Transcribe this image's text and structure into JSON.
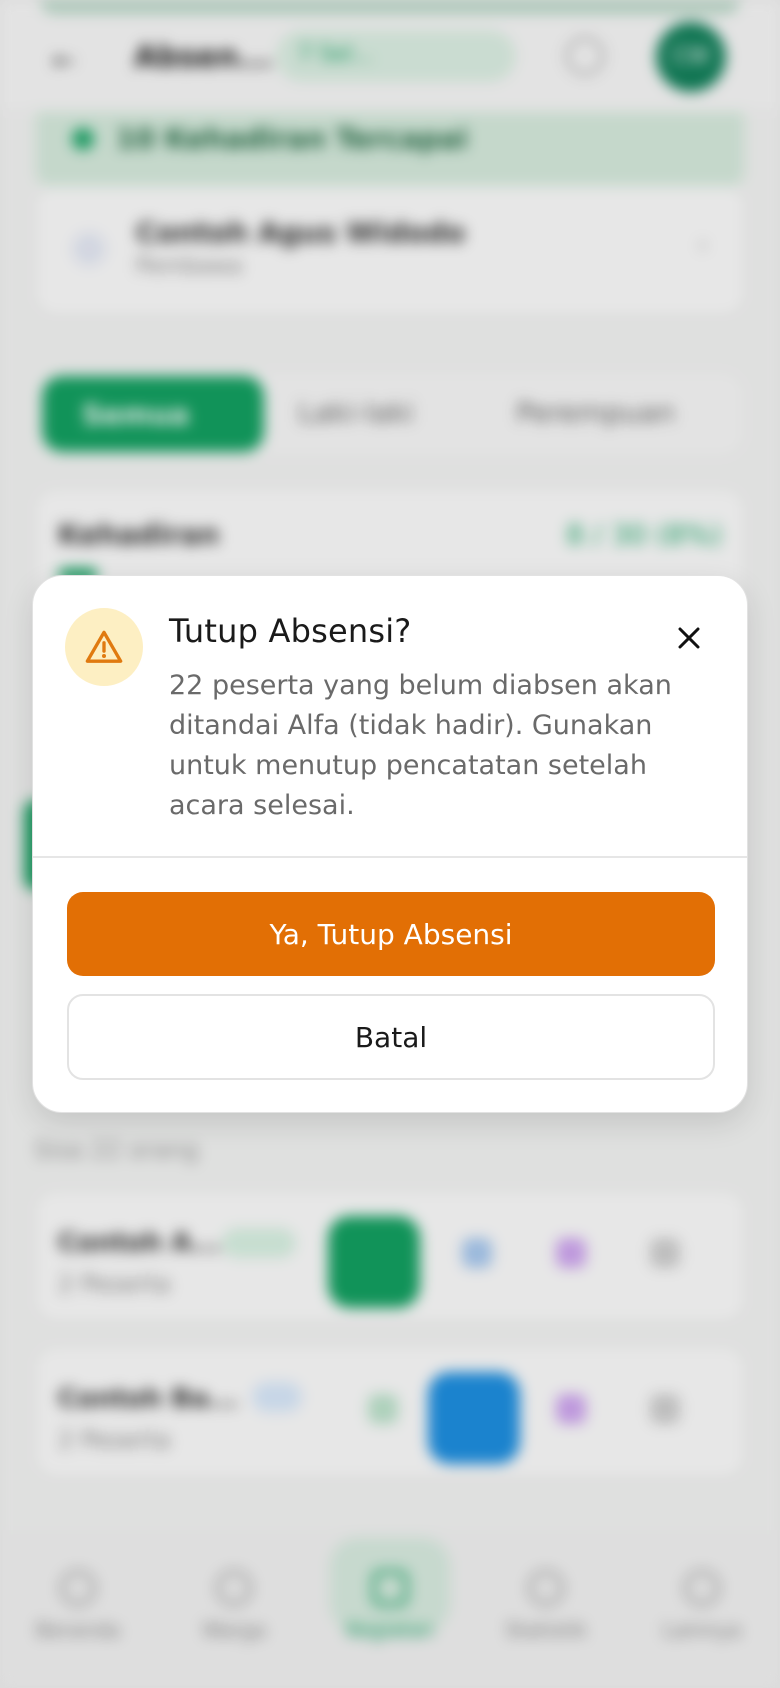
{
  "background": {
    "header": {
      "title": "Absen...",
      "event_pill": "7 Sel...",
      "avatar_initials": "CW"
    },
    "banner_text": "10 Kehadiran Tercapai",
    "participant_card": {
      "name": "Contoh Agus Widodo",
      "role": "Pembawa"
    },
    "filter_tabs": [
      "Semua",
      "Laki-laki",
      "Perempuan"
    ],
    "attendance_card": {
      "label": "Kehadiran",
      "value": "8 / 30 (8%)"
    },
    "list_label": "Sisa 22 orang",
    "rows": [
      {
        "name": "Contoh A...",
        "sub": "2 Peserta"
      },
      {
        "name": "Contoh Ba...",
        "sub": "2 Peserta"
      }
    ],
    "bottom_nav": [
      "Beranda",
      "Warga",
      "Kegiatan",
      "Statistik",
      "Lainnya"
    ]
  },
  "dialog": {
    "title": "Tutup Absensi?",
    "message": "22 peserta yang belum diabsen akan ditandai Alfa (tidak hadir). Gunakan untuk menutup pencatatan setelah acara selesai.",
    "confirm_label": "Ya, Tutup Absensi",
    "cancel_label": "Batal",
    "icon": "warning-triangle-icon",
    "close_icon": "close-icon"
  },
  "colors": {
    "confirm": "#e26f05",
    "warning_bg": "#fdefc3",
    "warning_icon": "#e07a10",
    "brand_green": "#13a061"
  }
}
